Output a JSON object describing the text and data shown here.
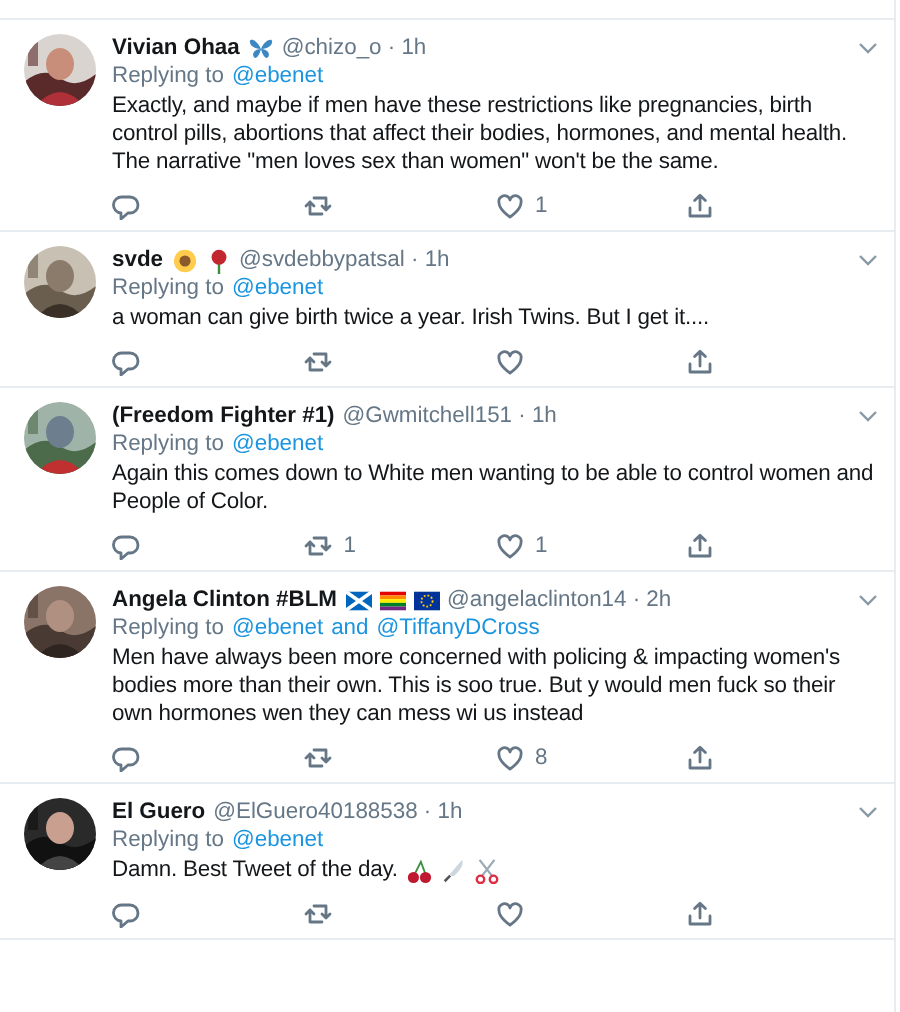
{
  "tweets": [
    {
      "name": "Vivian Ohaa",
      "meta": "@chizo_o · 1h",
      "replying_label": "Replying to",
      "mentions": [
        "@ebenet"
      ],
      "text": "Exactly, and maybe if men have these restrictions like pregnancies, birth control pills, abortions that affect their bodies, hormones, and mental health. The narrative \"men loves sex than women\" won't be the same.",
      "actions": [
        {
          "kind": "reply"
        },
        {
          "kind": "retweet"
        },
        {
          "kind": "like",
          "count": "1"
        },
        {
          "kind": "share"
        }
      ]
    },
    {
      "name": "svde",
      "meta": "@svdebbypatsal · 1h",
      "replying_label": "Replying to",
      "mentions": [
        "@ebenet"
      ],
      "text": "a woman can give birth twice a year. Irish Twins. But I get it....",
      "actions": [
        {
          "kind": "reply"
        },
        {
          "kind": "retweet"
        },
        {
          "kind": "like"
        },
        {
          "kind": "share"
        }
      ]
    },
    {
      "name": "(Freedom Fighter #1)",
      "meta": "@Gwmitchell151 · 1h",
      "replying_label": "Replying to",
      "mentions": [
        "@ebenet"
      ],
      "text": "Again this comes down to White men wanting to be able to control women and People of Color.",
      "actions": [
        {
          "kind": "reply"
        },
        {
          "kind": "retweet",
          "count": "1"
        },
        {
          "kind": "like",
          "count": "1"
        },
        {
          "kind": "share"
        }
      ]
    },
    {
      "name": "Angela Clinton #BLM",
      "meta": "@angelaclinton14 · 2h",
      "replying_label": "Replying to",
      "mentions": [
        "@ebenet",
        "@TiffanyDCross"
      ],
      "conjunction": "and",
      "text": "Men have always been more concerned with policing & impacting women's bodies more than their own. This is soo true. But y would men fuck so their own hormones wen they can mess wi us instead",
      "actions": [
        {
          "kind": "reply"
        },
        {
          "kind": "retweet"
        },
        {
          "kind": "like",
          "count": "8"
        },
        {
          "kind": "share"
        }
      ]
    },
    {
      "name": "El Guero",
      "meta": "@ElGuero40188538 · 1h",
      "replying_label": "Replying to",
      "mentions": [
        "@ebenet"
      ],
      "text": "Damn. Best Tweet of the day.",
      "actions": [
        {
          "kind": "reply"
        },
        {
          "kind": "retweet"
        },
        {
          "kind": "like"
        },
        {
          "kind": "share"
        }
      ]
    }
  ]
}
